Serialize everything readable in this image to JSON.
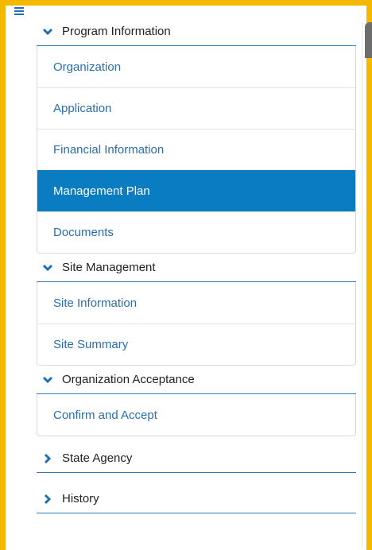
{
  "nav": {
    "sections": [
      {
        "title": "Program Information",
        "expanded": true,
        "items": [
          {
            "label": "Organization",
            "active": false
          },
          {
            "label": "Application",
            "active": false
          },
          {
            "label": "Financial Information",
            "active": false
          },
          {
            "label": "Management Plan",
            "active": true
          },
          {
            "label": "Documents",
            "active": false
          }
        ]
      },
      {
        "title": "Site Management",
        "expanded": true,
        "items": [
          {
            "label": "Site Information",
            "active": false
          },
          {
            "label": "Site Summary",
            "active": false
          }
        ]
      },
      {
        "title": "Organization Acceptance",
        "expanded": true,
        "items": [
          {
            "label": "Confirm and Accept",
            "active": false
          }
        ]
      },
      {
        "title": "State Agency",
        "expanded": false,
        "items": []
      },
      {
        "title": "History",
        "expanded": false,
        "items": []
      }
    ]
  },
  "colors": {
    "highlight_border": "#f5b800",
    "accent": "#0a7cc1",
    "link": "#2a6eb0"
  },
  "icons": {
    "menu": "hamburger-menu-icon",
    "expanded": "chevron-down-icon",
    "collapsed": "chevron-right-icon"
  }
}
